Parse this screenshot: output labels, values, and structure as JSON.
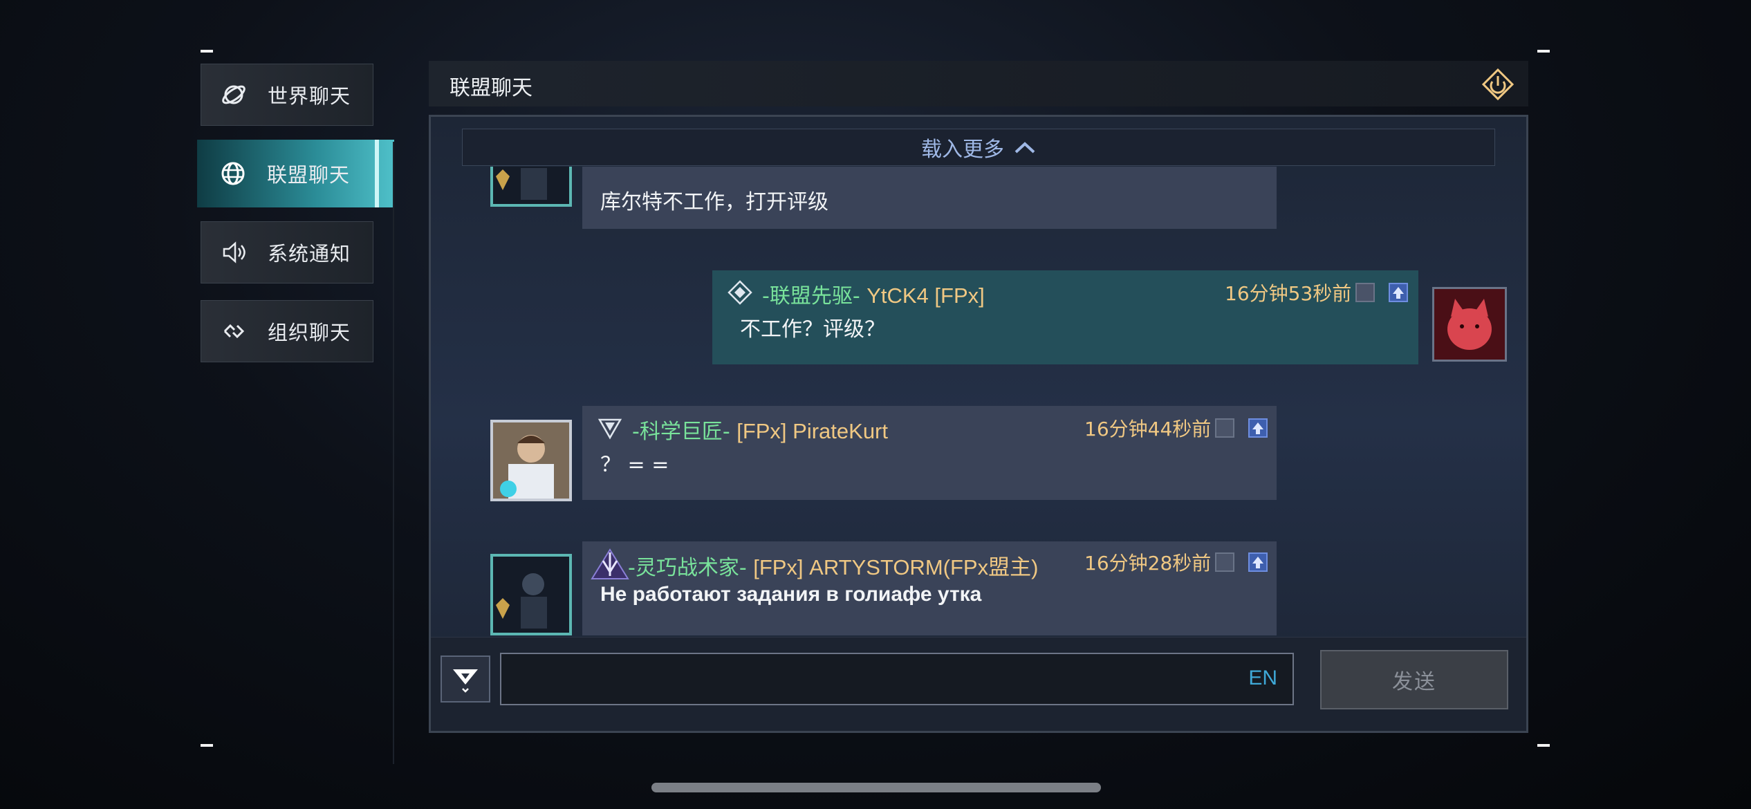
{
  "sidebar": {
    "items": [
      {
        "label": "世界聊天",
        "icon": "planet-icon"
      },
      {
        "label": "联盟聊天",
        "icon": "globe-icon",
        "active": true
      },
      {
        "label": "系统通知",
        "icon": "speaker-icon"
      },
      {
        "label": "组织聊天",
        "icon": "link-icon"
      }
    ]
  },
  "header": {
    "title": "联盟聊天",
    "exit_icon": "exit-icon"
  },
  "load_more": {
    "label": "载入更多"
  },
  "messages": [
    {
      "text": "库尔特不工作，打开评级"
    },
    {
      "rank": "-联盟先驱-",
      "player": "YtCK4 [FPx]",
      "time": "16分钟53秒前",
      "text": "不工作？评级？",
      "self": true
    },
    {
      "rank": "-科学巨匠-",
      "player": "[FPx] PirateKurt",
      "time": "16分钟44秒前",
      "text": "？ = ="
    },
    {
      "rank": "-灵巧战术家-",
      "player": "[FPx] ARTYSTORM(FPx盟主)",
      "time": "16分钟28秒前",
      "text": "Не работают задания в голиафе утка"
    }
  ],
  "input": {
    "placeholder": "",
    "lang": "EN",
    "send_label": "发送"
  },
  "colors": {
    "accent": "#4fc0c9",
    "rank_green": "#79e39b",
    "gold": "#f0c883",
    "self_bubble": "#244f5a",
    "bubble": "#3a4358"
  }
}
